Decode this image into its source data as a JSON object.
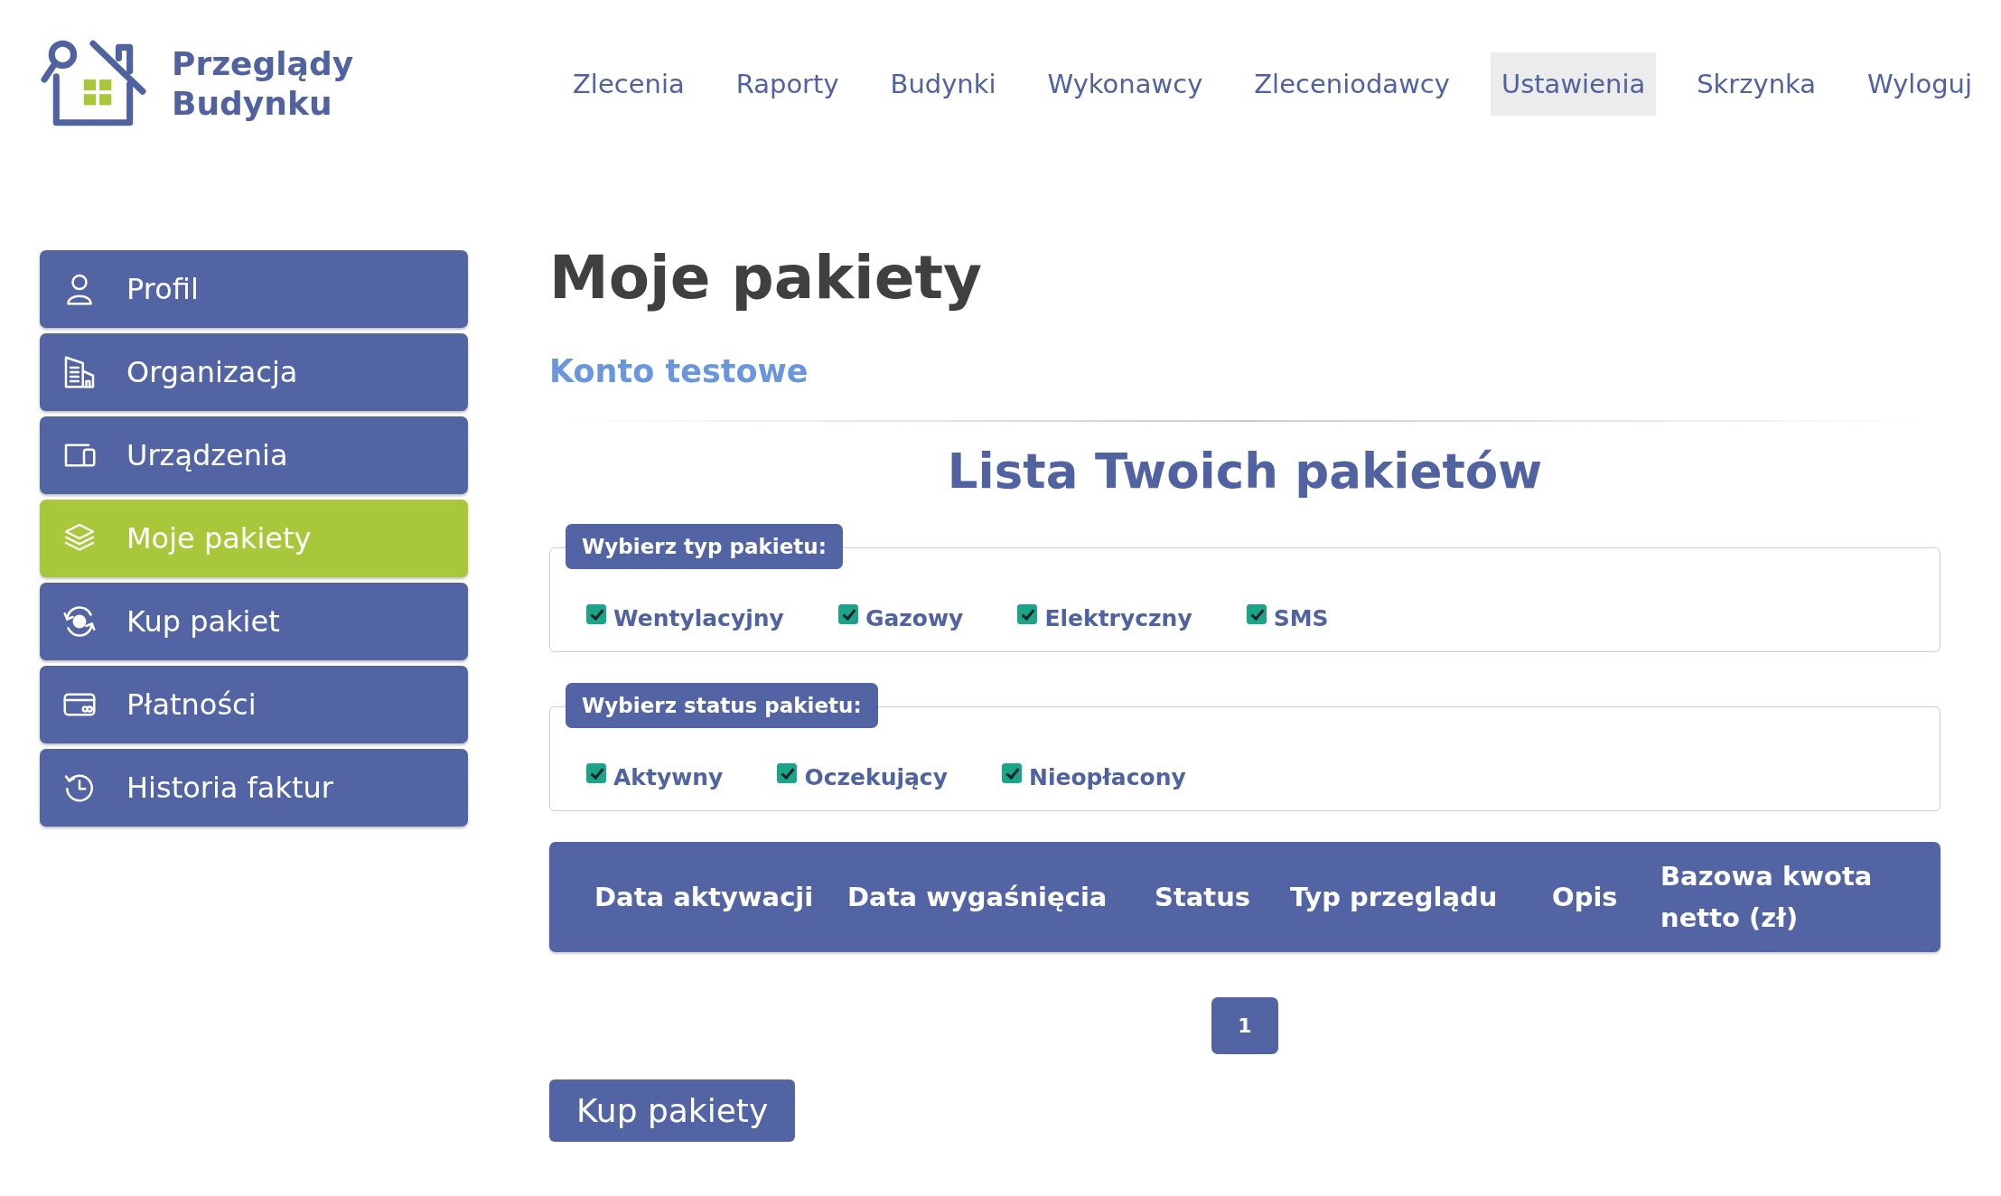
{
  "logo": {
    "line_1": "Przeglądy",
    "line_2": "Budynku"
  },
  "nav": [
    {
      "label": "Zlecenia",
      "selected": false
    },
    {
      "label": "Raporty",
      "selected": false
    },
    {
      "label": "Budynki",
      "selected": false
    },
    {
      "label": "Wykonawcy",
      "selected": false
    },
    {
      "label": "Zleceniodawcy",
      "selected": false
    },
    {
      "label": "Ustawienia",
      "selected": true
    },
    {
      "label": "Skrzynka",
      "selected": false
    },
    {
      "label": "Wyloguj",
      "selected": false
    }
  ],
  "sidebar": {
    "items": [
      {
        "label": "Profil",
        "selected": false
      },
      {
        "label": "Organizacja",
        "selected": false
      },
      {
        "label": "Urządzenia",
        "selected": false
      },
      {
        "label": "Moje pakiety",
        "selected": true
      },
      {
        "label": "Kup pakiet",
        "selected": false
      },
      {
        "label": "Płatności",
        "selected": false
      },
      {
        "label": "Historia faktur",
        "selected": false
      }
    ]
  },
  "page": {
    "title": "Moje pakiety",
    "account": "Konto testowe",
    "list_title": "Lista Twoich pakietów"
  },
  "filters": [
    {
      "legend": "Wybierz typ pakietu:",
      "options": [
        {
          "label": "Wentylacyjny",
          "checked": true
        },
        {
          "label": "Gazowy",
          "checked": true
        },
        {
          "label": "Elektryczny",
          "checked": true
        },
        {
          "label": "SMS",
          "checked": true
        }
      ]
    },
    {
      "legend": "Wybierz status pakietu:",
      "options": [
        {
          "label": "Aktywny",
          "checked": true
        },
        {
          "label": "Oczekujący",
          "checked": true
        },
        {
          "label": "Nieopłacony",
          "checked": true
        }
      ]
    }
  ],
  "table": {
    "columns": [
      "Data aktywacji",
      "Data wygaśnięcia",
      "Status",
      "Typ przeglądu",
      "Opis",
      "Bazowa kwota netto (zł)"
    ]
  },
  "pagination": [
    {
      "label": "1",
      "selected": true
    }
  ],
  "buy_button": "Kup pakiety"
}
